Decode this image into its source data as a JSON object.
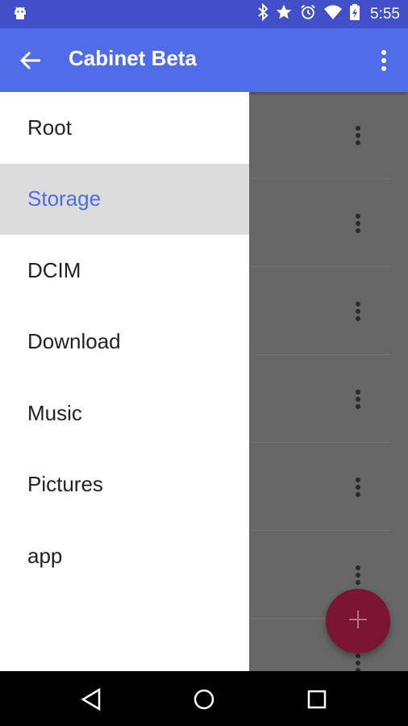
{
  "status_bar": {
    "time": "5:55",
    "icons": [
      "android-debug-icon",
      "bluetooth-icon",
      "star-icon",
      "alarm-icon",
      "wifi-icon",
      "battery-charging-icon"
    ]
  },
  "app_bar": {
    "title": "Cabinet Beta",
    "back_icon": "arrow-back-icon",
    "overflow_icon": "more-vert-icon"
  },
  "drawer": {
    "items": [
      {
        "label": "Root",
        "selected": false
      },
      {
        "label": "Storage",
        "selected": true
      },
      {
        "label": "DCIM",
        "selected": false
      },
      {
        "label": "Download",
        "selected": false
      },
      {
        "label": "Music",
        "selected": false
      },
      {
        "label": "Pictures",
        "selected": false
      },
      {
        "label": "app",
        "selected": false
      }
    ]
  },
  "list_rows": {
    "count": 7,
    "row_icon": "more-vert-icon"
  },
  "fab": {
    "icon": "add-icon",
    "color": "#7a1434"
  },
  "colors": {
    "accent": "#4f6de6",
    "status_bar": "#4150c9",
    "scrim": "#666666"
  },
  "nav_bar": {
    "icons": [
      "back-triangle-icon",
      "home-circle-icon",
      "recents-square-icon"
    ]
  }
}
